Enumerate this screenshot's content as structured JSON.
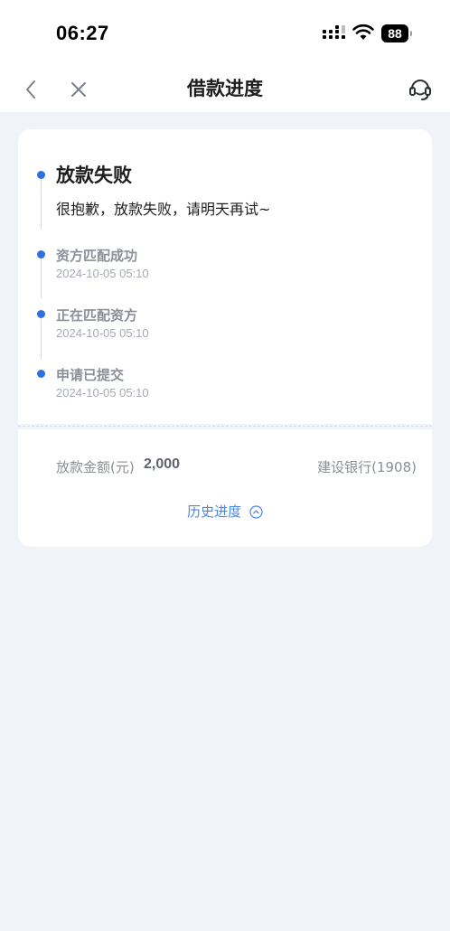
{
  "status_bar": {
    "time": "06:27",
    "battery": "88",
    "icons": [
      "signal-icon",
      "wifi-icon",
      "battery-icon"
    ]
  },
  "nav": {
    "title": "借款进度",
    "icons": [
      "back-icon",
      "close-icon",
      "customer-service-icon"
    ]
  },
  "progress": {
    "current": {
      "title": "放款失败",
      "desc": "很抱歉，放款失败，请明天再试~"
    },
    "steps": [
      {
        "title": "资方匹配成功",
        "time": "2024-10-05 05:10"
      },
      {
        "title": "正在匹配资方",
        "time": "2024-10-05 05:10"
      },
      {
        "title": "申请已提交",
        "time": "2024-10-05 05:10"
      }
    ]
  },
  "loan": {
    "amount_label": "放款金额(元)",
    "amount_value": "2,000",
    "bank": "建设银行(1908)"
  },
  "history": {
    "label": "历史进度"
  },
  "colors": {
    "accent": "#2f6fe4",
    "link": "#4a86e6",
    "background": "#f0f3f8",
    "card": "#ffffff"
  }
}
